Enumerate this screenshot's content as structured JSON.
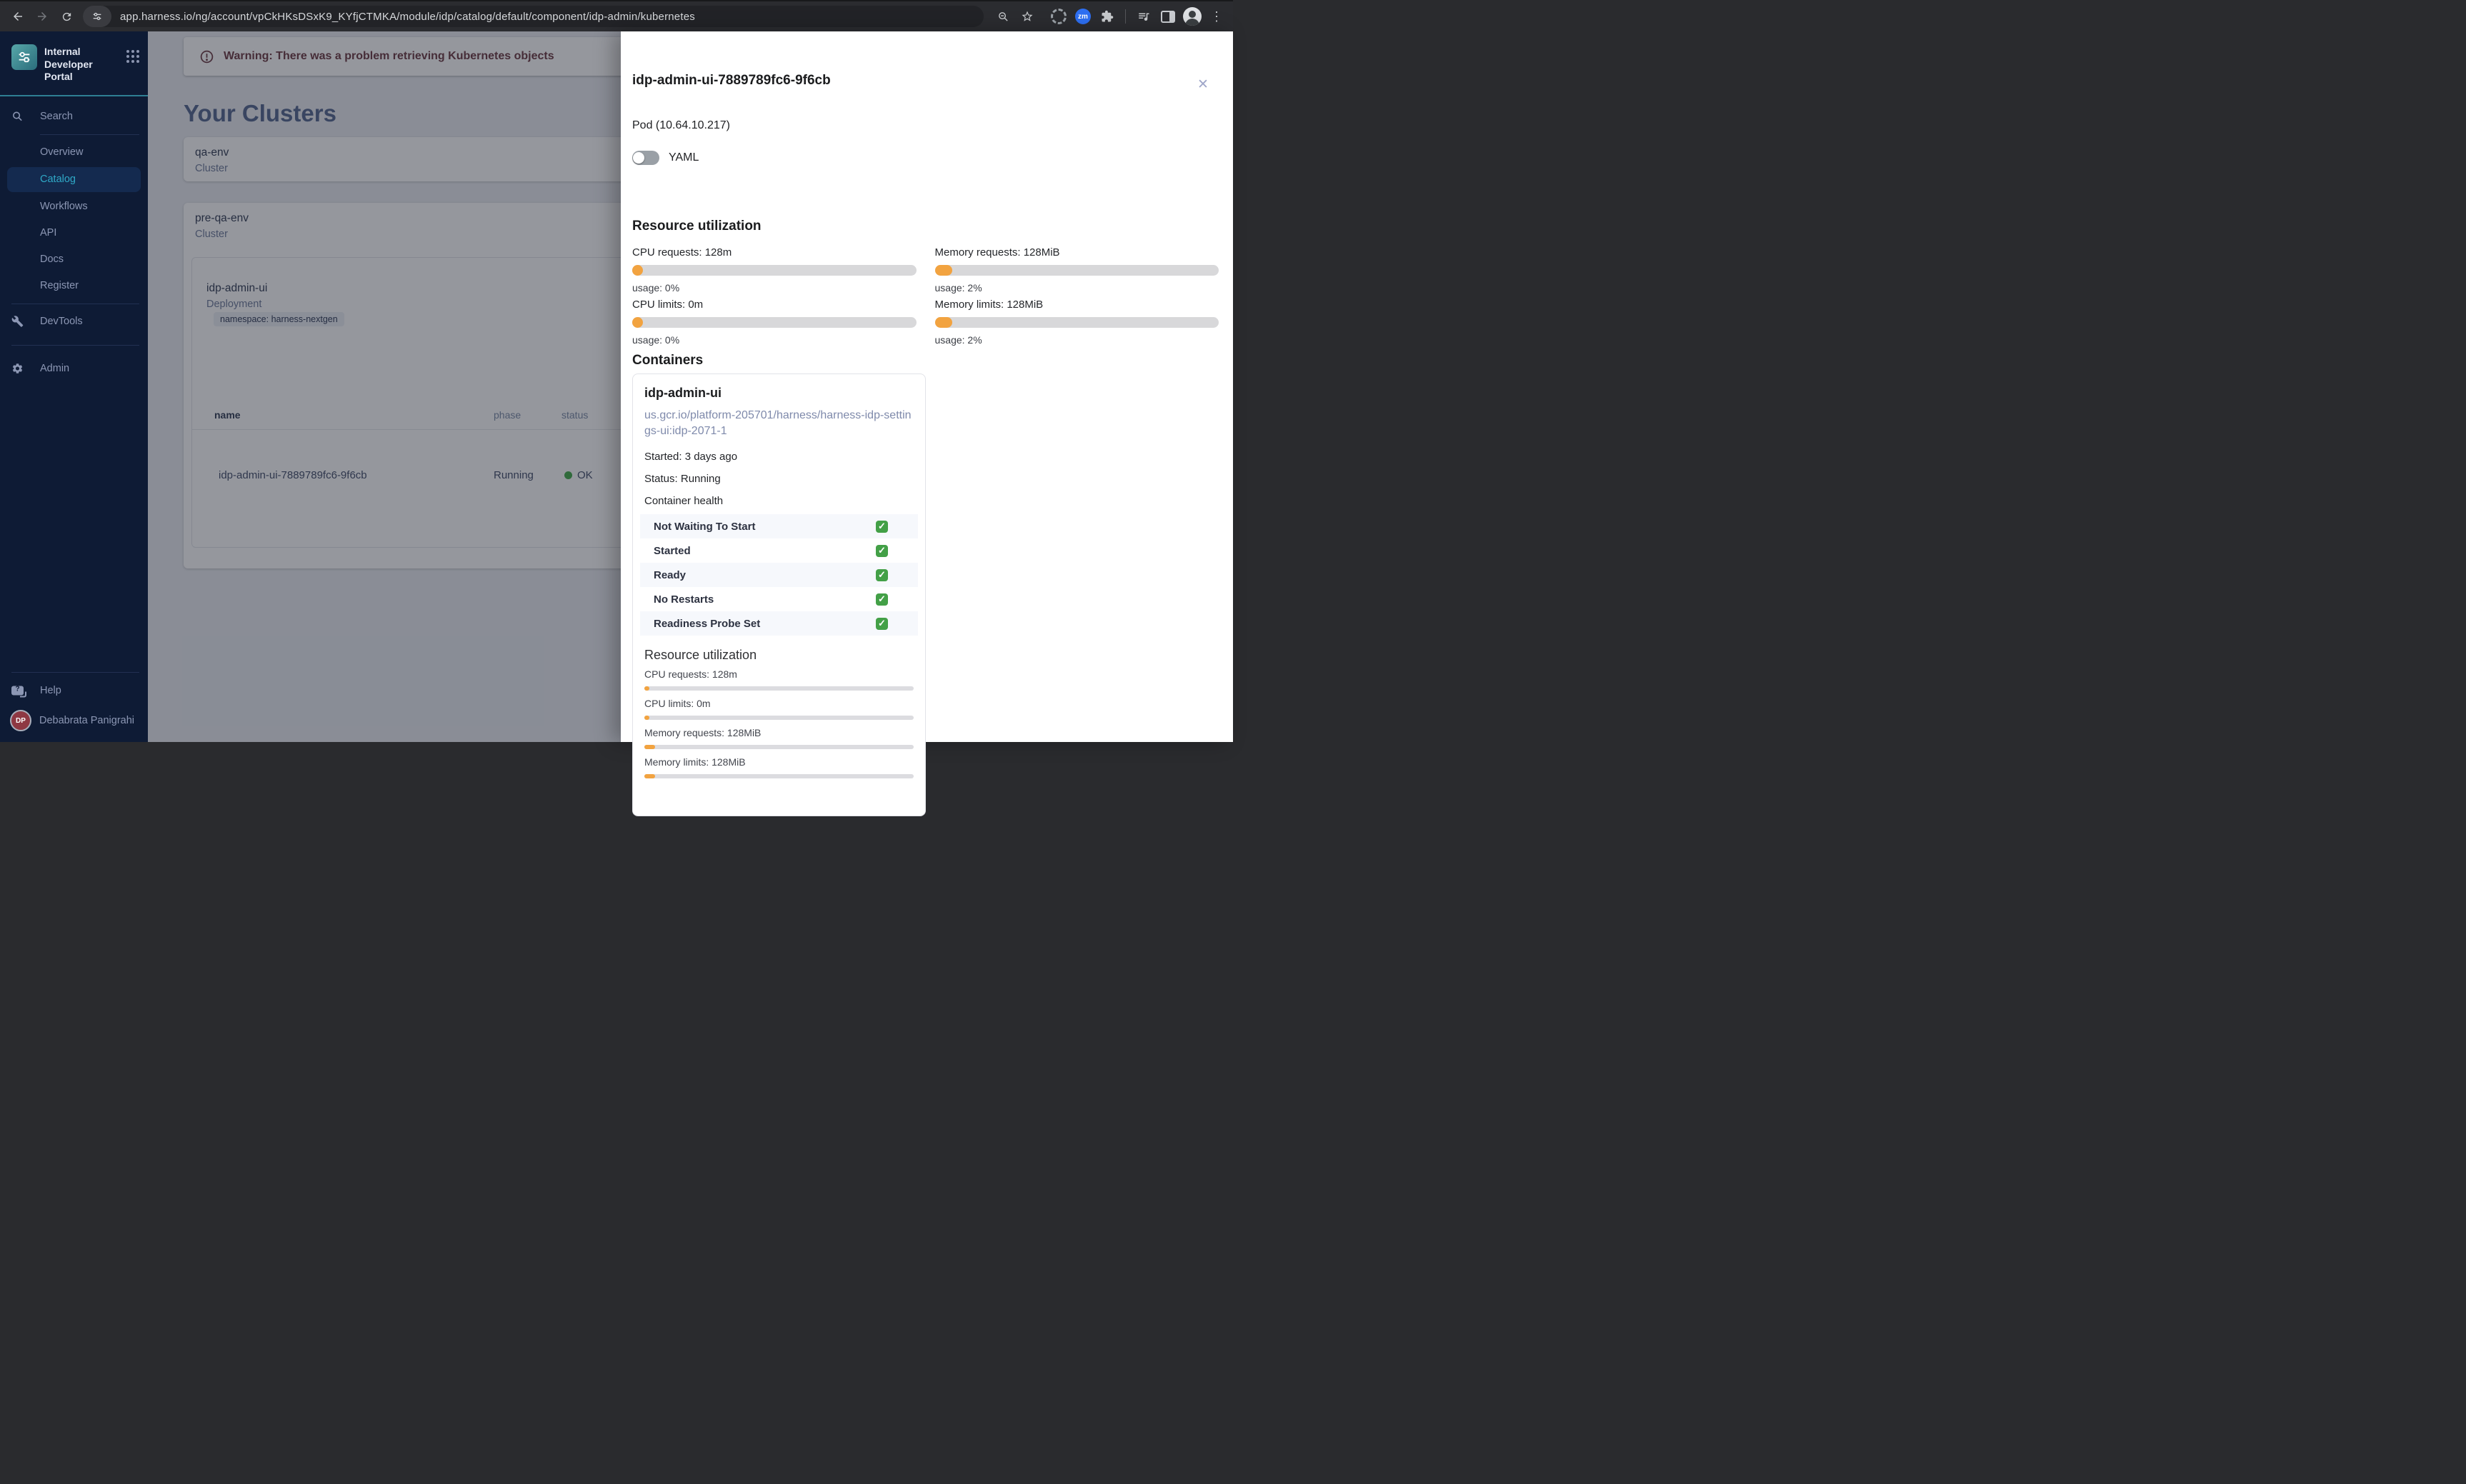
{
  "browser": {
    "url": "app.harness.io/ng/account/vpCkHKsDSxK9_KYfjCTMKA/module/idp/catalog/default/component/idp-admin/kubernetes",
    "zoom_badge": "zm"
  },
  "icons": {
    "check": "✓",
    "close": "✕",
    "kebab": "⋮"
  },
  "sidebar": {
    "brand_title": "Internal Developer Portal",
    "items": [
      {
        "label": "Search"
      },
      {
        "label": "Overview"
      },
      {
        "label": "Catalog"
      },
      {
        "label": "Workflows"
      },
      {
        "label": "API"
      },
      {
        "label": "Docs"
      },
      {
        "label": "Register"
      },
      {
        "label": "DevTools"
      },
      {
        "label": "Admin"
      }
    ],
    "help_label": "Help",
    "user": {
      "initials": "DP",
      "name": "Debabrata Panigrahi"
    }
  },
  "main": {
    "warning": "Warning: There was a problem retrieving Kubernetes objects",
    "heading": "Your Clusters",
    "clusters": [
      {
        "name": "qa-env",
        "kind": "Cluster"
      },
      {
        "name": "pre-qa-env",
        "kind": "Cluster"
      }
    ],
    "deployment": {
      "name": "idp-admin-ui",
      "kind": "Deployment",
      "namespace_chip": "namespace: harness-nextgen",
      "table": {
        "headers": [
          "name",
          "phase",
          "status"
        ],
        "rows": [
          {
            "name": "idp-admin-ui-7889789fc6-9f6cb",
            "phase": "Running",
            "status": "OK"
          }
        ]
      }
    }
  },
  "drawer": {
    "title": "idp-admin-ui-7889789fc6-9f6cb",
    "subtitle": "Pod (10.64.10.217)",
    "yaml_toggle_label": "YAML",
    "resource_utilization": {
      "heading": "Resource utilization",
      "items": [
        {
          "label": "CPU requests: 128m",
          "usage": "usage: 0%",
          "percent": 0
        },
        {
          "label": "Memory requests: 128MiB",
          "usage": "usage: 2%",
          "percent": 2
        },
        {
          "label": "CPU limits: 0m",
          "usage": "usage: 0%",
          "percent": 0
        },
        {
          "label": "Memory limits: 128MiB",
          "usage": "usage: 2%",
          "percent": 2
        }
      ]
    },
    "containers": {
      "heading": "Containers",
      "card": {
        "name": "idp-admin-ui",
        "image": "us.gcr.io/platform-205701/harness/harness-idp-settings-ui:idp-2071-1",
        "started": "Started: 3 days ago",
        "status": "Status: Running",
        "health_title": "Container health",
        "health": [
          {
            "label": "Not Waiting To Start"
          },
          {
            "label": "Started"
          },
          {
            "label": "Ready"
          },
          {
            "label": "No Restarts"
          },
          {
            "label": "Readiness Probe Set"
          }
        ],
        "resource_utilization": {
          "heading": "Resource utilization",
          "items": [
            {
              "label": "CPU requests: 128m",
              "percent": 1
            },
            {
              "label": "CPU limits: 0m",
              "percent": 1
            },
            {
              "label": "Memory requests: 128MiB",
              "percent": 3
            },
            {
              "label": "Memory limits: 128MiB",
              "percent": 3
            }
          ]
        }
      }
    }
  },
  "colors": {
    "accent_teal": "#2FA9C7",
    "orange": "#F2A340",
    "green": "#43A047",
    "sidebar_bg": "#0E1B35",
    "avatar_red": "#8E3843"
  }
}
